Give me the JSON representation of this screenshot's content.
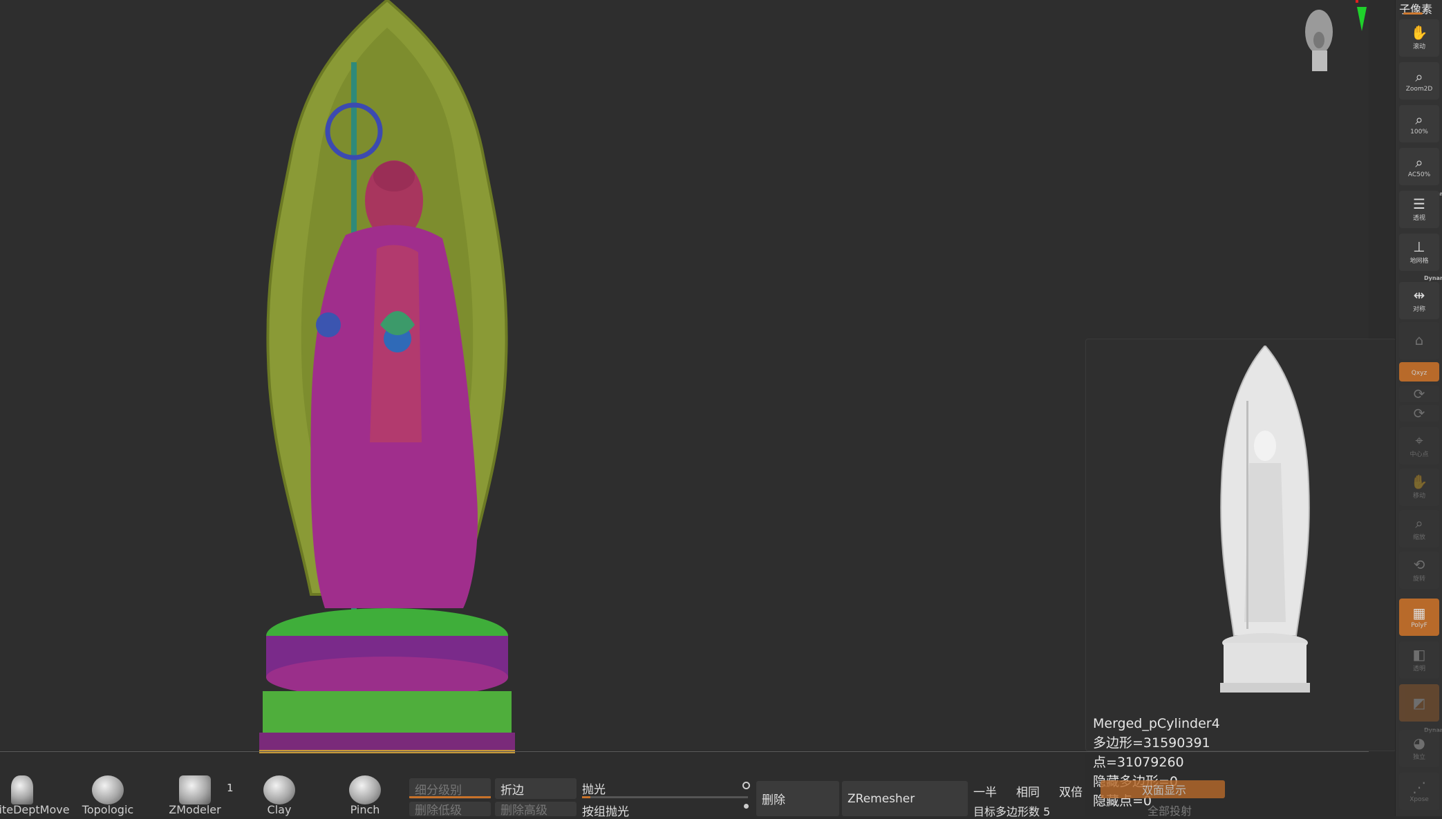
{
  "viewport": {
    "colors": {
      "background": "#2e2e2e",
      "halo": "#8a9a36",
      "robe": "#a02e8c",
      "lotus_green": "#3fae3a",
      "lotus_purple": "#7a2a8a"
    }
  },
  "right_shelf": {
    "title": "子像素",
    "buttons": [
      {
        "icon": "move-hand-icon",
        "glyph": "✋",
        "label": "滚动",
        "state": "normal"
      },
      {
        "icon": "zoom2d-icon",
        "glyph": "🔍",
        "label": "Zoom2D",
        "state": "normal"
      },
      {
        "icon": "zoom-100-icon",
        "glyph": "🔍",
        "label": "100%",
        "state": "normal"
      },
      {
        "icon": "zoom-ac50-icon",
        "glyph": "🔍",
        "label": "AC50%",
        "state": "normal"
      },
      {
        "icon": "perspective-icon",
        "glyph": "☰",
        "label": "透视",
        "state": "normal"
      },
      {
        "icon": "floor-grid-icon",
        "glyph": "⊥",
        "label": "地网格",
        "state": "normal"
      },
      {
        "icon": "symmetry-icon",
        "glyph": "⇹",
        "label": "对称",
        "state": "normal"
      },
      {
        "icon": "local-icon",
        "glyph": "⌂",
        "label": "",
        "state": "faded"
      },
      {
        "icon": "xyz-rotate-icon",
        "glyph": "",
        "label": "Qxyz",
        "state": "active"
      },
      {
        "icon": "rotate-y-icon",
        "glyph": "⟳",
        "label": "",
        "state": "faded"
      },
      {
        "icon": "rotate-z-icon",
        "glyph": "⟳",
        "label": "",
        "state": "faded"
      },
      {
        "icon": "center-point-icon",
        "glyph": "⌖",
        "label": "中心点",
        "state": "faded"
      },
      {
        "icon": "move-icon",
        "glyph": "✋",
        "label": "移动",
        "state": "faded"
      },
      {
        "icon": "scale-icon",
        "glyph": "🔍",
        "label": "缩放",
        "state": "faded"
      },
      {
        "icon": "rotate-icon",
        "glyph": "⟲",
        "label": "旋转",
        "state": "faded"
      },
      {
        "icon": "polyframe-icon",
        "glyph": "▦",
        "label": "PolyF",
        "state": "active"
      },
      {
        "icon": "transparent-icon",
        "glyph": "◧",
        "label": "透明",
        "state": "faded"
      },
      {
        "icon": "ghost-icon",
        "glyph": "◩",
        "label": "",
        "state": "faded"
      },
      {
        "icon": "solo-icon",
        "glyph": "◕",
        "label": "独立",
        "state": "faded"
      },
      {
        "icon": "xpose-icon",
        "glyph": "⋰",
        "label": "Xpose",
        "state": "faded"
      }
    ],
    "dynamic_labels": [
      "Dynamic",
      "Dynamic",
      "Dynamic"
    ]
  },
  "preview_panel": {
    "name": "Merged_pCylinder4",
    "polygons": "多边形=31590391",
    "points": "点=31079260",
    "hidden_polygons": "隐藏多边形=0",
    "hidden_points": "隐藏点=0",
    "orange_button": "双面显示",
    "ghost_text": "全部投射"
  },
  "bottom_bar": {
    "brushes": [
      {
        "label": "InfiniteDeptMove"
      },
      {
        "label": "Topologic"
      },
      {
        "label": "ZModeler"
      },
      {
        "label": "Clay"
      },
      {
        "label": "Pinch"
      }
    ],
    "zmodeler_count": "1",
    "subdiv_level": "细分级别",
    "delete_lower": "删除低级",
    "crease": "折边",
    "delete_higher": "删除高级",
    "polish": "抛光",
    "polish_by_group": "按组抛光",
    "delete": "删除",
    "zremesher": "ZRemesher",
    "half": "一半",
    "same": "相同",
    "double": "双倍",
    "target_polys": "目标多边形数 5"
  }
}
